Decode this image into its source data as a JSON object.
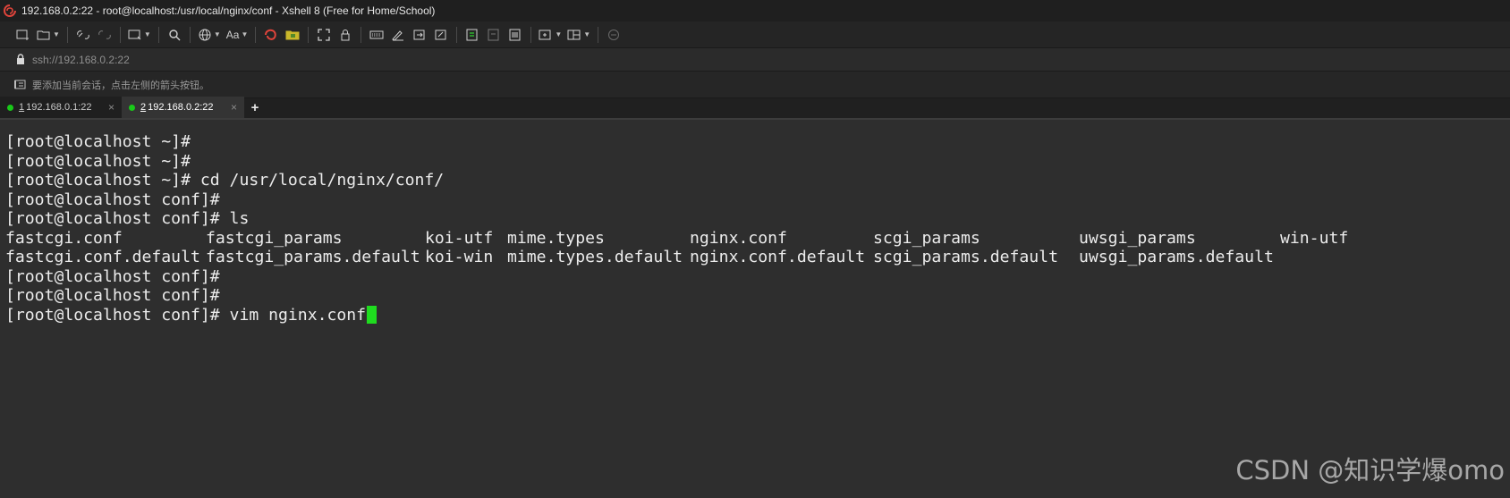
{
  "window": {
    "title": "192.168.0.2:22 - root@localhost:/usr/local/nginx/conf - Xshell 8 (Free for Home/School)"
  },
  "address_bar": {
    "value": "ssh://192.168.0.2:22"
  },
  "hint_bar": {
    "text": "要添加当前会话，点击左侧的箭头按钮。"
  },
  "tabs": [
    {
      "number": "1",
      "label": " 192.168.0.1:22",
      "status_color": "#19c919",
      "close": "×",
      "active": false
    },
    {
      "number": "2",
      "label": " 192.168.0.2:22",
      "status_color": "#19c919",
      "close": "×",
      "active": true
    }
  ],
  "add_tab_label": "+",
  "terminal": {
    "lines": [
      "[root@localhost ~]#",
      "[root@localhost ~]#",
      "[root@localhost ~]# cd /usr/local/nginx/conf/",
      "[root@localhost conf]#",
      "[root@localhost conf]# ls"
    ],
    "ls_output": [
      [
        "fastcgi.conf",
        "fastcgi_params",
        "koi-utf",
        "mime.types",
        "nginx.conf",
        "scgi_params",
        "uwsgi_params",
        "win-utf"
      ],
      [
        "fastcgi.conf.default",
        "fastcgi_params.default",
        "koi-win",
        "mime.types.default",
        "nginx.conf.default",
        "scgi_params.default",
        "uwsgi_params.default",
        ""
      ]
    ],
    "after_lines": [
      "[root@localhost conf]#",
      "[root@localhost conf]#"
    ],
    "current_line": "[root@localhost conf]# vim nginx.conf",
    "cursor_color": "#1fdc1f"
  },
  "watermark": "CSDN @知识学爆omo",
  "colors": {
    "terminal_bg": "#2e2e2e",
    "terminal_fg": "#ececec",
    "accent_red": "#e0443b",
    "accent_green": "#19c919"
  }
}
